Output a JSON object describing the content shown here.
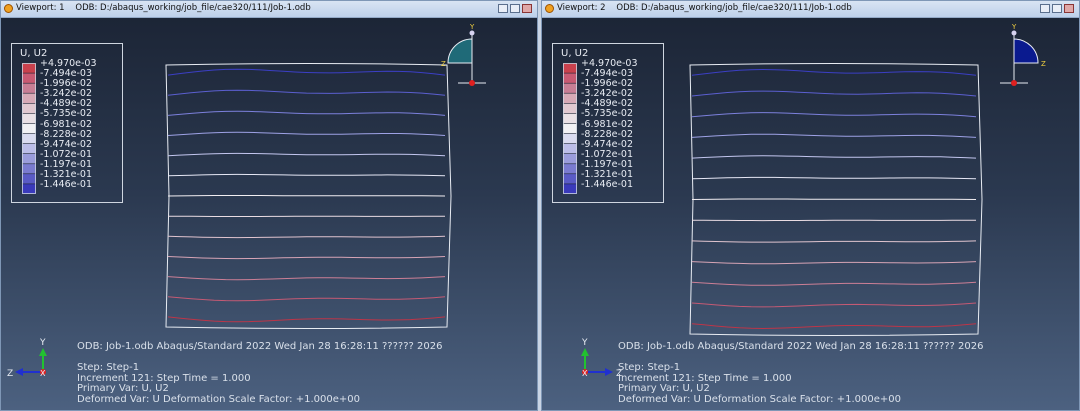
{
  "viewports": [
    {
      "title": "Viewport: 1",
      "odb_path": "ODB: D:/abaqus_working/job_file/cae320/111/Job-1.odb",
      "triad_side": "left"
    },
    {
      "title": "Viewport: 2",
      "odb_path": "ODB: D:/abaqus_working/job_file/cae320/111/Job-1.odb",
      "triad_side": "right"
    }
  ],
  "legend": {
    "title": "U, U2",
    "values": [
      "+4.970e-03",
      "-7.494e-03",
      "-1.996e-02",
      "-3.242e-02",
      "-4.489e-02",
      "-5.735e-02",
      "-6.981e-02",
      "-8.228e-02",
      "-9.474e-02",
      "-1.072e-01",
      "-1.197e-01",
      "-1.321e-01",
      "-1.446e-01"
    ],
    "colors": [
      "#c9414d",
      "#c85a73",
      "#c77e95",
      "#d6a9b6",
      "#e0c8d0",
      "#e9e0e5",
      "#f1f1f4",
      "#d9dbf0",
      "#bbbde8",
      "#9a9cdb",
      "#7a7bd0",
      "#5a5bc6",
      "#3a3abb"
    ]
  },
  "info": {
    "line1": "ODB: Job-1.odb    Abaqus/Standard 2022    Wed Jan 28 16:28:11 ?????? 2026",
    "step": "Step: Step-1",
    "increment": "Increment     121: Step Time =     1.000",
    "primary_var": "Primary Var: U, U2",
    "deformed_var": "Deformed Var: U   Deformation Scale Factor: +1.000e+00"
  },
  "triad_labels": {
    "y": "Y",
    "z": "Z",
    "x": "X"
  },
  "colors": {
    "background_top": "#1c2536",
    "background_bottom": "#4c6180",
    "mesh_edge": "#e8ecf3",
    "triad_cap": "#1f6a78",
    "triad_cap_2": "#0a1a8f"
  }
}
